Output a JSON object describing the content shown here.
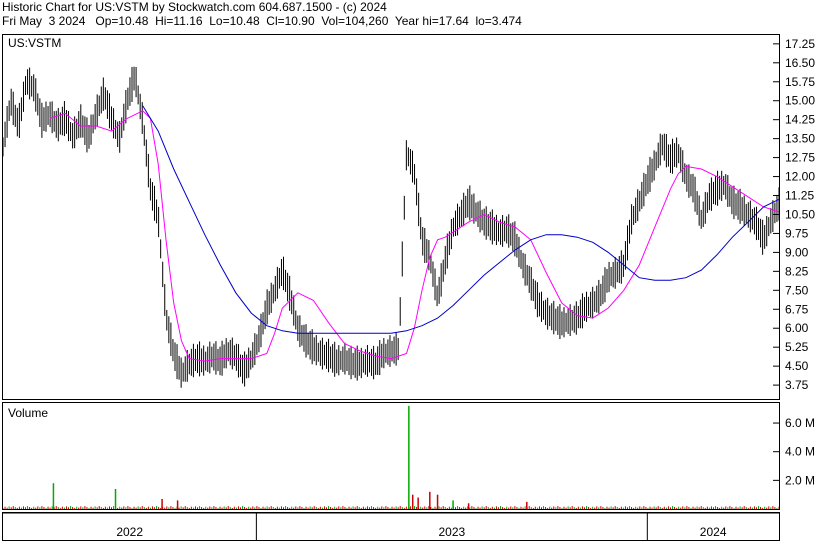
{
  "header": {
    "line1": "Historic Chart for US:VSTM by Stockwatch.com 604.687.1500 - (c) 2024",
    "line2": "Fri May  3 2024   Op=10.48  Hi=11.16  Lo=10.48  Cl=10.90  Vol=104,260  Year hi=17.64  lo=3.474"
  },
  "price_panel": {
    "label": "US:VSTM"
  },
  "volume_panel": {
    "label": "Volume"
  },
  "chart_data": [
    {
      "type": "line",
      "title": "US:VSTM",
      "ylim": [
        3.2,
        17.6
      ],
      "y_ticks": [
        "17.25",
        "16.50",
        "15.75",
        "15.00",
        "14.25",
        "13.50",
        "12.75",
        "12.00",
        "11.25",
        "10.50",
        "9.75",
        "9.00",
        "8.25",
        "7.50",
        "6.75",
        "6.00",
        "5.25",
        "4.50",
        "3.75"
      ],
      "x_labels": [
        "2022",
        "2023",
        "2024"
      ],
      "x_boundaries": [
        0.0,
        0.3265,
        0.8303,
        1.0
      ],
      "series": [
        {
          "role": "price",
          "color": "#000000",
          "x": [
            0,
            0.01,
            0.02,
            0.03,
            0.04,
            0.05,
            0.06,
            0.07,
            0.08,
            0.09,
            0.1,
            0.11,
            0.12,
            0.13,
            0.14,
            0.15,
            0.16,
            0.17,
            0.18,
            0.19,
            0.2,
            0.21,
            0.22,
            0.23,
            0.24,
            0.25,
            0.26,
            0.27,
            0.28,
            0.29,
            0.3,
            0.31,
            0.32,
            0.33,
            0.34,
            0.35,
            0.36,
            0.37,
            0.38,
            0.39,
            0.4,
            0.41,
            0.42,
            0.43,
            0.44,
            0.45,
            0.46,
            0.47,
            0.48,
            0.49,
            0.5,
            0.51,
            0.52,
            0.53,
            0.54,
            0.55,
            0.56,
            0.57,
            0.58,
            0.59,
            0.6,
            0.61,
            0.62,
            0.63,
            0.64,
            0.65,
            0.66,
            0.67,
            0.68,
            0.69,
            0.7,
            0.71,
            0.72,
            0.73,
            0.74,
            0.75,
            0.76,
            0.77,
            0.78,
            0.79,
            0.8,
            0.81,
            0.82,
            0.83,
            0.84,
            0.85,
            0.86,
            0.87,
            0.88,
            0.89,
            0.9,
            0.91,
            0.92,
            0.93,
            0.94,
            0.95,
            0.96,
            0.97,
            0.98,
            0.99,
            1.0
          ],
          "values": [
            13.2,
            15.0,
            14.0,
            15.8,
            15.5,
            14.2,
            14.5,
            14.0,
            14.3,
            13.6,
            14.2,
            13.5,
            14.5,
            15.3,
            14.3,
            13.5,
            15.0,
            16.0,
            14.2,
            11.5,
            10.4,
            6.5,
            5.0,
            4.2,
            4.6,
            4.8,
            4.7,
            4.9,
            4.7,
            5.1,
            4.9,
            4.3,
            4.8,
            5.6,
            6.8,
            7.5,
            8.3,
            7.3,
            6.0,
            5.5,
            5.2,
            5.0,
            4.9,
            4.7,
            4.8,
            4.6,
            4.6,
            4.7,
            4.6,
            5.0,
            5.1,
            5.2,
            13.0,
            12.2,
            9.5,
            8.8,
            7.2,
            8.7,
            10.0,
            10.5,
            11.0,
            10.6,
            10.2,
            10.0,
            9.8,
            9.9,
            9.5,
            8.5,
            7.8,
            7.0,
            6.6,
            6.4,
            6.2,
            6.3,
            6.4,
            6.8,
            7.0,
            7.3,
            8.0,
            8.2,
            8.5,
            10.3,
            11.0,
            11.8,
            12.5,
            13.3,
            12.7,
            13.0,
            12.0,
            11.5,
            10.3,
            11.2,
            11.5,
            11.7,
            11.0,
            10.8,
            10.5,
            10.2,
            9.5,
            10.3,
            10.9
          ]
        },
        {
          "role": "moving-average-short",
          "color": "#ff00ff",
          "x": [
            0.06,
            0.08,
            0.1,
            0.12,
            0.14,
            0.16,
            0.18,
            0.19,
            0.2,
            0.21,
            0.22,
            0.23,
            0.24,
            0.26,
            0.28,
            0.3,
            0.32,
            0.34,
            0.35,
            0.36,
            0.38,
            0.4,
            0.42,
            0.44,
            0.46,
            0.48,
            0.5,
            0.52,
            0.53,
            0.54,
            0.55,
            0.56,
            0.57,
            0.58,
            0.6,
            0.62,
            0.64,
            0.66,
            0.68,
            0.7,
            0.72,
            0.74,
            0.76,
            0.78,
            0.8,
            0.82,
            0.84,
            0.86,
            0.87,
            0.88,
            0.9,
            0.92,
            0.94,
            0.96,
            0.98,
            1.0
          ],
          "values": [
            14.3,
            14.5,
            14.0,
            14.0,
            13.8,
            14.3,
            14.6,
            14.3,
            12.5,
            9.5,
            7.0,
            5.5,
            4.8,
            4.7,
            4.8,
            4.8,
            4.8,
            5.0,
            5.8,
            6.8,
            7.4,
            7.1,
            6.2,
            5.4,
            5.1,
            4.9,
            4.8,
            5.0,
            6.0,
            7.5,
            8.8,
            9.5,
            9.6,
            9.8,
            10.2,
            10.5,
            10.2,
            10.0,
            9.5,
            8.2,
            7.0,
            6.5,
            6.4,
            6.8,
            7.5,
            8.5,
            10.0,
            11.5,
            12.1,
            12.4,
            12.3,
            12.0,
            11.6,
            11.2,
            10.8,
            10.6
          ]
        },
        {
          "role": "moving-average-long",
          "color": "#0000cc",
          "x": [
            0.18,
            0.2,
            0.22,
            0.24,
            0.26,
            0.28,
            0.3,
            0.32,
            0.34,
            0.36,
            0.38,
            0.4,
            0.42,
            0.44,
            0.46,
            0.48,
            0.5,
            0.52,
            0.54,
            0.56,
            0.58,
            0.6,
            0.62,
            0.64,
            0.66,
            0.68,
            0.7,
            0.72,
            0.74,
            0.76,
            0.78,
            0.8,
            0.82,
            0.84,
            0.86,
            0.88,
            0.9,
            0.92,
            0.94,
            0.96,
            0.98,
            1.0
          ],
          "values": [
            14.8,
            13.8,
            12.3,
            11.0,
            9.7,
            8.5,
            7.4,
            6.6,
            6.1,
            5.9,
            5.8,
            5.8,
            5.8,
            5.8,
            5.8,
            5.8,
            5.8,
            5.9,
            6.1,
            6.4,
            6.9,
            7.5,
            8.1,
            8.6,
            9.1,
            9.5,
            9.7,
            9.7,
            9.6,
            9.4,
            9.0,
            8.5,
            8.0,
            7.9,
            7.9,
            8.0,
            8.3,
            8.9,
            9.6,
            10.2,
            10.8,
            11.1
          ]
        }
      ]
    },
    {
      "type": "bar",
      "title": "Volume",
      "ylim": [
        0,
        7.4
      ],
      "y_ticks": [
        "6.0 M",
        "4.0 M",
        "2.0 M"
      ],
      "spikes": [
        {
          "x": 0.065,
          "value": 1.8,
          "color": "#00aa00"
        },
        {
          "x": 0.145,
          "value": 1.4,
          "color": "#00aa00"
        },
        {
          "x": 0.205,
          "value": 0.7,
          "color": "#cc0000"
        },
        {
          "x": 0.225,
          "value": 0.6,
          "color": "#cc0000"
        },
        {
          "x": 0.523,
          "value": 7.2,
          "color": "#00aa00"
        },
        {
          "x": 0.528,
          "value": 1.0,
          "color": "#cc0000"
        },
        {
          "x": 0.535,
          "value": 0.8,
          "color": "#cc0000"
        },
        {
          "x": 0.55,
          "value": 1.2,
          "color": "#cc0000"
        },
        {
          "x": 0.56,
          "value": 1.0,
          "color": "#cc0000"
        },
        {
          "x": 0.58,
          "value": 0.6,
          "color": "#00aa00"
        },
        {
          "x": 0.6,
          "value": 0.4,
          "color": "#cc0000"
        },
        {
          "x": 0.675,
          "value": 0.5,
          "color": "#cc0000"
        }
      ],
      "baseline_level": 0.15
    }
  ]
}
